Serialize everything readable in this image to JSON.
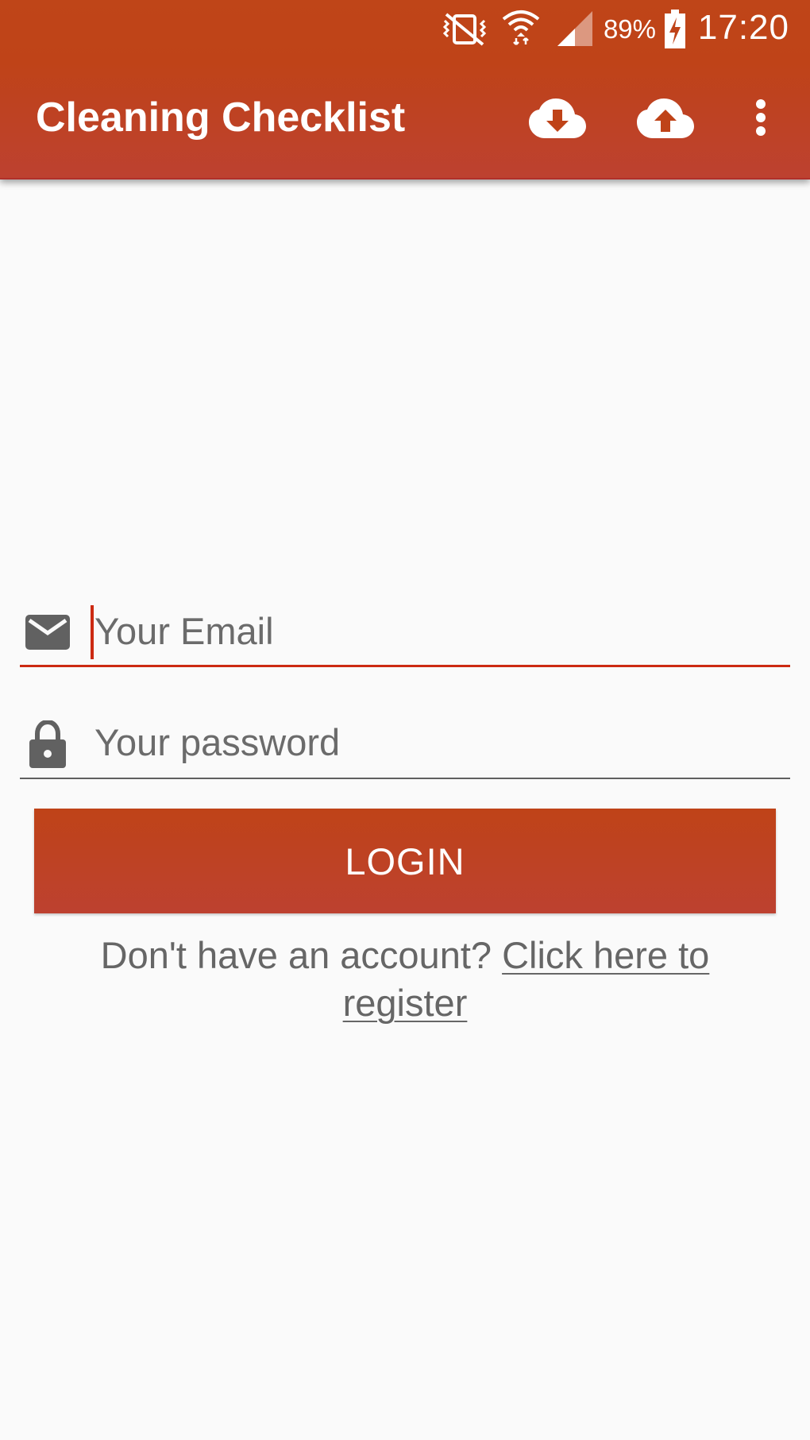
{
  "status_bar": {
    "battery_percent": "89%",
    "time": "17:20",
    "icons": [
      "vibrate-mute-icon",
      "wifi-icon",
      "signal-icon",
      "battery-charging-icon"
    ]
  },
  "app_bar": {
    "title": "Cleaning Checklist",
    "actions": [
      "cloud-download-icon",
      "cloud-upload-icon",
      "more-vert-icon"
    ]
  },
  "login_form": {
    "email": {
      "placeholder": "Your Email",
      "value": "",
      "icon": "email-icon"
    },
    "password": {
      "placeholder": "Your password",
      "value": "",
      "icon": "lock-icon"
    },
    "login_label": "LOGIN",
    "register_prompt": "Don't have an account?",
    "register_link": "Click here to register"
  },
  "colors": {
    "primary": "#bf4318",
    "accent": "#cc2a12",
    "background": "#fafafa",
    "icon_gray": "#606060"
  }
}
